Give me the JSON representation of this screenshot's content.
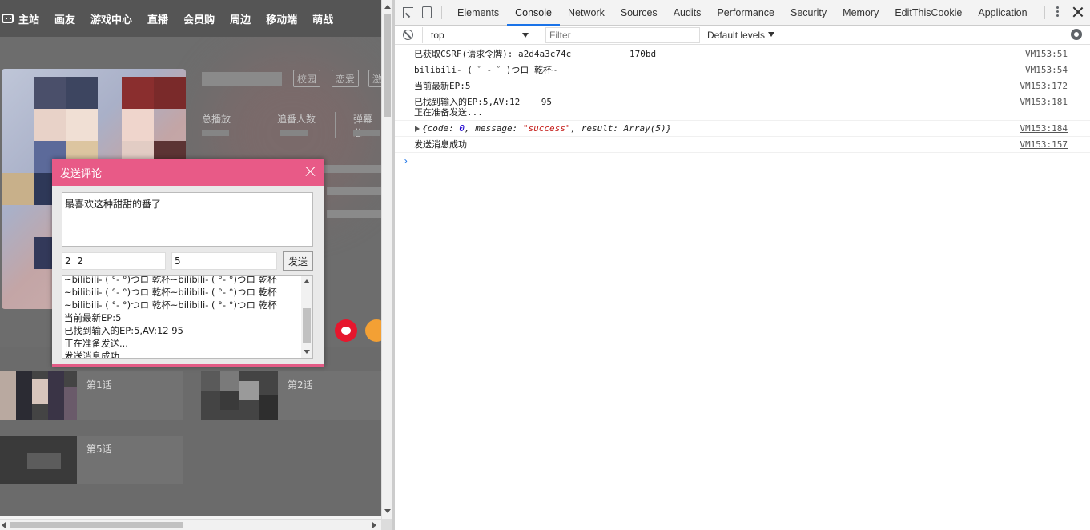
{
  "page": {
    "nav": {
      "items": [
        {
          "label": "主站"
        },
        {
          "label": "画友"
        },
        {
          "label": "游戏中心"
        },
        {
          "label": "直播"
        },
        {
          "label": "会员购"
        },
        {
          "label": "周边"
        },
        {
          "label": "移动端"
        },
        {
          "label": "萌战"
        }
      ]
    },
    "banner": {
      "tags": [
        "校园",
        "恋爱",
        "激"
      ],
      "stats": [
        {
          "label": "总播放"
        },
        {
          "label": "追番人数"
        },
        {
          "label": "弹幕总"
        }
      ]
    },
    "episodes": [
      {
        "label": "第1话"
      },
      {
        "label": "第2话"
      },
      {
        "label": "第5话"
      }
    ]
  },
  "dialog": {
    "title": "发送评论",
    "comment": "最喜欢这种甜甜的番了",
    "input_left": "2  2",
    "input_right": "5",
    "send_label": "发送",
    "log_lines": [
      "~bilibili- (  °- °)つロ 乾杯~bilibili- (  °- °)つロ 乾杯",
      "~bilibili- (  °- °)つロ 乾杯~bilibili- (  °- °)つロ 乾杯",
      "~bilibili- (  °- °)つロ 乾杯~bilibili- (  °- °)つロ 乾杯",
      "当前最新EP:5",
      "已找到输入的EP:5,AV:12        95",
      "正在准备发送...",
      "发送消息成功"
    ]
  },
  "devtools": {
    "tabs": [
      {
        "label": "Elements",
        "active": false
      },
      {
        "label": "Console",
        "active": true
      },
      {
        "label": "Network",
        "active": false
      },
      {
        "label": "Sources",
        "active": false
      },
      {
        "label": "Audits",
        "active": false
      },
      {
        "label": "Performance",
        "active": false
      },
      {
        "label": "Security",
        "active": false
      },
      {
        "label": "Memory",
        "active": false
      },
      {
        "label": "EditThisCookie",
        "active": false
      },
      {
        "label": "Application",
        "active": false
      }
    ],
    "context": "top",
    "filter_placeholder": "Filter",
    "levels": "Default levels",
    "messages": [
      {
        "text": "已获取CSRF(请求令牌): a2d4a3c74c           170bd",
        "source": "VM153:51"
      },
      {
        "text": "bilibili- ( ゜- ゜)つロ 乾杯~",
        "source": "VM153:54"
      },
      {
        "text": "当前最新EP:5",
        "source": "VM153:172"
      },
      {
        "text": "已找到输入的EP:5,AV:12    95\n正在准备发送...",
        "source": "VM153:181"
      },
      {
        "text": "",
        "source": "VM153:184",
        "object": {
          "prefix": "{code: ",
          "code": "0",
          "mid": ", message: ",
          "message": "\"success\"",
          "suffix": ", result: Array(5)}"
        }
      },
      {
        "text": "发送消息成功",
        "source": "VM153:157"
      }
    ],
    "prompt": "›"
  },
  "colors": {
    "dialog_header": "#e85a87",
    "active_tab_underline": "#1a73e8",
    "string_red": "#c41a16",
    "number_blue": "#1c00cf"
  }
}
